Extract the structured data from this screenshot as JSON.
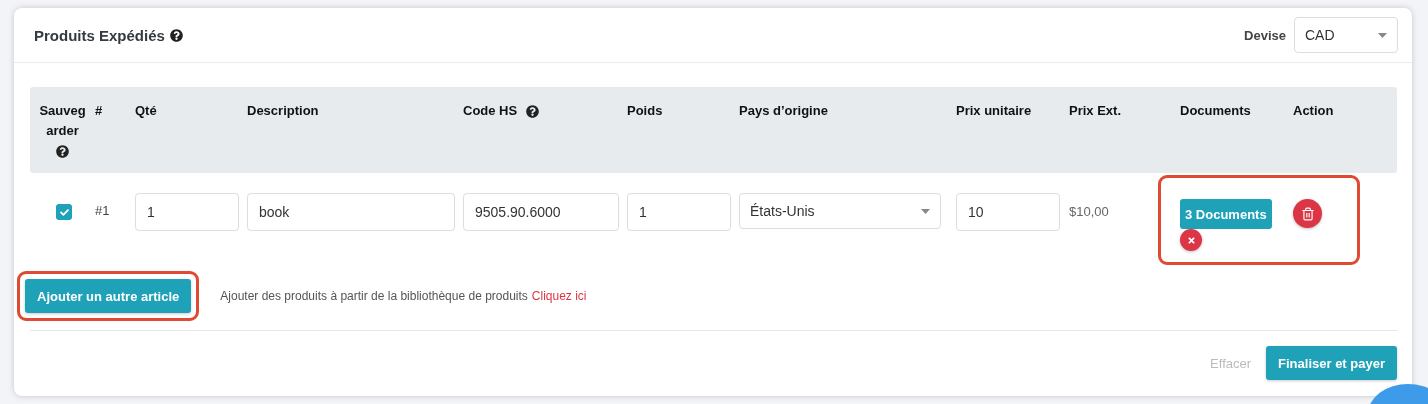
{
  "title": "Produits Expédiés",
  "title_help": true,
  "currency": {
    "label": "Devise",
    "value": "CAD"
  },
  "columns": [
    {
      "label": "Sauvegarder",
      "help": true
    },
    {
      "label": "#",
      "help": false
    },
    {
      "label": "Qté",
      "help": false
    },
    {
      "label": "Description",
      "help": false
    },
    {
      "label": "Code HS",
      "help": true
    },
    {
      "label": "Poids",
      "help": false
    },
    {
      "label": "Pays d’origine",
      "help": false
    },
    {
      "label": "Prix unitaire",
      "help": false
    },
    {
      "label": "Prix Ext.",
      "help": false
    },
    {
      "label": "Documents",
      "help": false
    },
    {
      "label": "Action",
      "help": false
    }
  ],
  "rows": [
    {
      "saved": true,
      "number": "#1",
      "qty": "1",
      "description": "book",
      "hs_code": "9505.90.6000",
      "weight": "1",
      "origin": "États-Unis",
      "unit_price": "10",
      "ext_price": "$10,00",
      "documents": "3 Documents",
      "actions_highlighted": true
    }
  ],
  "add_button": {
    "label": "Ajouter un autre article",
    "highlighted": true
  },
  "library_text": "Ajouter des produits à partir de la bibliothèque de produits",
  "library_link": "Cliquez ici",
  "clear_button": {
    "label": "Effacer",
    "disabled": true
  },
  "submit_button": {
    "label": "Finaliser et payer"
  }
}
